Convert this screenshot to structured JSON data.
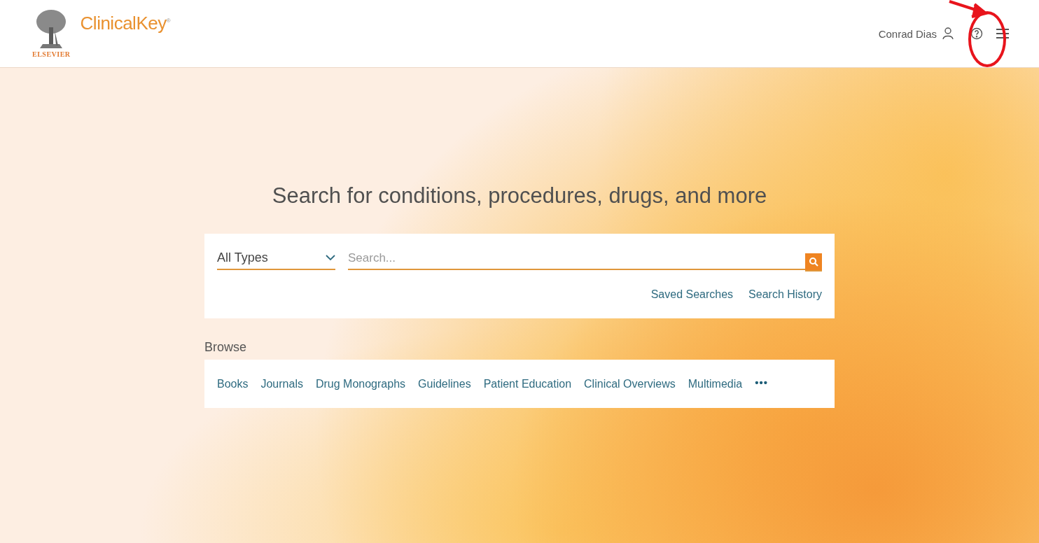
{
  "header": {
    "logo_wordmark": "ELSEVIER",
    "product": "ClinicalKey$^{®}$",
    "user_name": "Conrad Dias"
  },
  "heading": "Search for conditions, procedures, drugs, and more",
  "search": {
    "type_select": "All Types",
    "placeholder": "Search...",
    "links": [
      "Saved Searches",
      "Search History"
    ]
  },
  "browse": {
    "label": "Browse",
    "items": [
      "Books",
      "Journals",
      "Drug Monographs",
      "Guidelines",
      "Patient Education",
      "Clinical Overviews",
      "Multimedia"
    ],
    "more": "•••"
  }
}
